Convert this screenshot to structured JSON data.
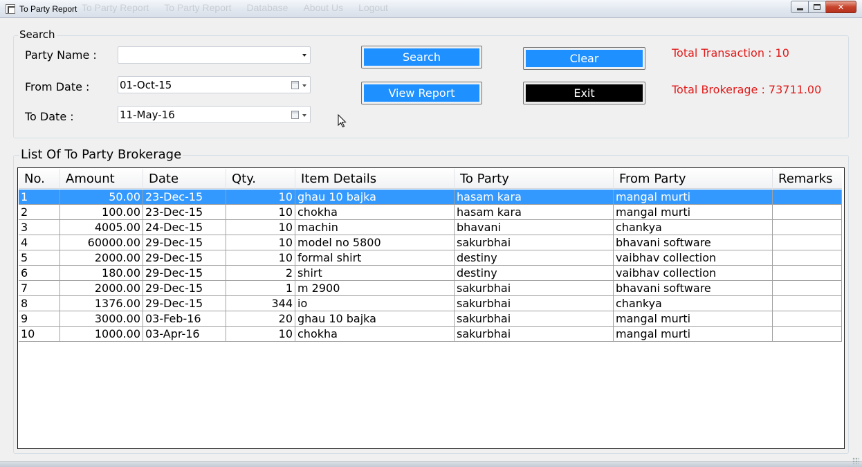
{
  "window": {
    "title": "To Party Report",
    "ghost_menu": [
      "To Party Report",
      "To Party Report",
      "Database",
      "About Us",
      "Logout"
    ]
  },
  "search": {
    "legend": "Search",
    "party_name_label": "Party Name :",
    "party_name_value": "",
    "from_date_label": "From Date :",
    "from_date_value": "01-Oct-15",
    "to_date_label": "To Date :",
    "to_date_value": "11-May-16",
    "search_button": "Search",
    "view_report_button": "View Report",
    "clear_button": "Clear",
    "exit_button": "Exit",
    "total_transaction": "Total Transaction : 10",
    "total_brokerage": "Total Brokerage : 73711.00"
  },
  "list": {
    "legend": "List Of To Party Brokerage",
    "columns": [
      "No.",
      "Amount",
      "Date",
      "Qty.",
      "Item Details",
      "To Party",
      "From Party",
      "Remarks"
    ],
    "selected_row": 0,
    "rows": [
      [
        "1",
        "50.00",
        "23-Dec-15",
        "10",
        "ghau 10 bajka",
        "hasam kara",
        "mangal murti",
        ""
      ],
      [
        "2",
        "100.00",
        "23-Dec-15",
        "10",
        "chokha",
        "hasam kara",
        "mangal murti",
        ""
      ],
      [
        "3",
        "4005.00",
        "24-Dec-15",
        "10",
        "machin",
        "bhavani",
        "chankya",
        ""
      ],
      [
        "4",
        "60000.00",
        "29-Dec-15",
        "10",
        "model no 5800",
        "sakurbhai",
        "bhavani software",
        ""
      ],
      [
        "5",
        "2000.00",
        "29-Dec-15",
        "10",
        "formal shirt",
        "destiny",
        "vaibhav collection",
        ""
      ],
      [
        "6",
        "180.00",
        "29-Dec-15",
        "2",
        "shirt",
        "destiny",
        "vaibhav collection",
        ""
      ],
      [
        "7",
        "2000.00",
        "29-Dec-15",
        "1",
        "m 2900",
        "sakurbhai",
        "bhavani software",
        ""
      ],
      [
        "8",
        "1376.00",
        "29-Dec-15",
        "344",
        "io",
        "sakurbhai",
        "chankya",
        ""
      ],
      [
        "9",
        "3000.00",
        "03-Feb-16",
        "20",
        "ghau 10 bajka",
        "sakurbhai",
        "mangal murti",
        ""
      ],
      [
        "10",
        "1000.00",
        "03-Apr-16",
        "10",
        "chokha",
        "sakurbhai",
        "mangal murti",
        ""
      ]
    ]
  },
  "colors": {
    "accent_button": "#1e90ff",
    "selected_row": "#3399ff",
    "stat_text": "#e01b1b"
  }
}
